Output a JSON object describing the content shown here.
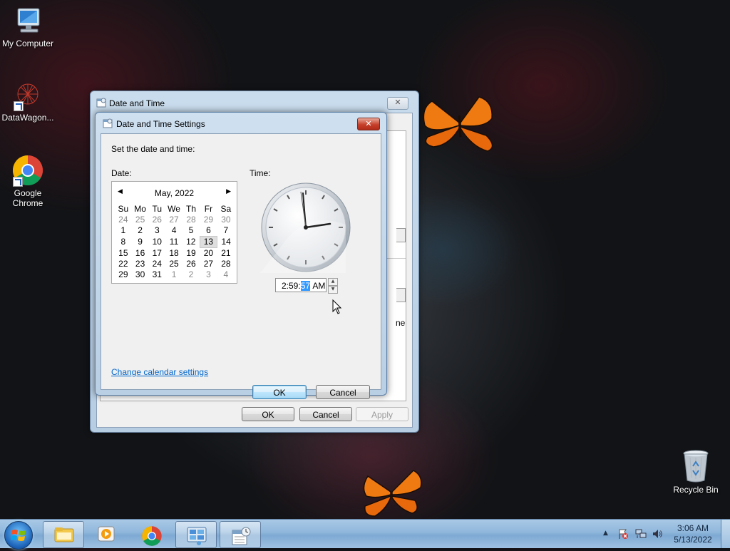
{
  "desktop": {
    "icons": [
      {
        "label": "My Computer"
      },
      {
        "label": "DataWagon..."
      },
      {
        "label": "Google Chrome"
      }
    ],
    "recycle_bin": "Recycle Bin"
  },
  "outer_window": {
    "title": "Date and Time",
    "close_label": "✕",
    "buttons": {
      "ok": "OK",
      "cancel": "Cancel",
      "apply": "Apply"
    },
    "partial_text": "ne"
  },
  "dialog": {
    "title": "Date and Time Settings",
    "close_label": "✕",
    "instruction": "Set the date and time:",
    "date_label": "Date:",
    "time_label": "Time:",
    "calendar": {
      "month_year": "May, 2022",
      "weekdays": [
        "Su",
        "Mo",
        "Tu",
        "We",
        "Th",
        "Fr",
        "Sa"
      ],
      "weeks": [
        [
          "24",
          "25",
          "26",
          "27",
          "28",
          "29",
          "30"
        ],
        [
          "1",
          "2",
          "3",
          "4",
          "5",
          "6",
          "7"
        ],
        [
          "8",
          "9",
          "10",
          "11",
          "12",
          "13",
          "14"
        ],
        [
          "15",
          "16",
          "17",
          "18",
          "19",
          "20",
          "21"
        ],
        [
          "22",
          "23",
          "24",
          "25",
          "26",
          "27",
          "28"
        ],
        [
          "29",
          "30",
          "31",
          "1",
          "2",
          "3",
          "4"
        ]
      ],
      "selected_day": "13"
    },
    "time": {
      "hours_minutes": "2:59:",
      "seconds": "57",
      "ampm": "AM"
    },
    "change_calendar_link": "Change calendar settings",
    "ok": "OK",
    "cancel": "Cancel"
  },
  "taskbar": {
    "time": "3:06 AM",
    "date": "5/13/2022",
    "tray_arrow": "▲"
  },
  "colors": {
    "accent": "#3399ff",
    "link": "#0066cc",
    "close_red": "#c6402b"
  }
}
